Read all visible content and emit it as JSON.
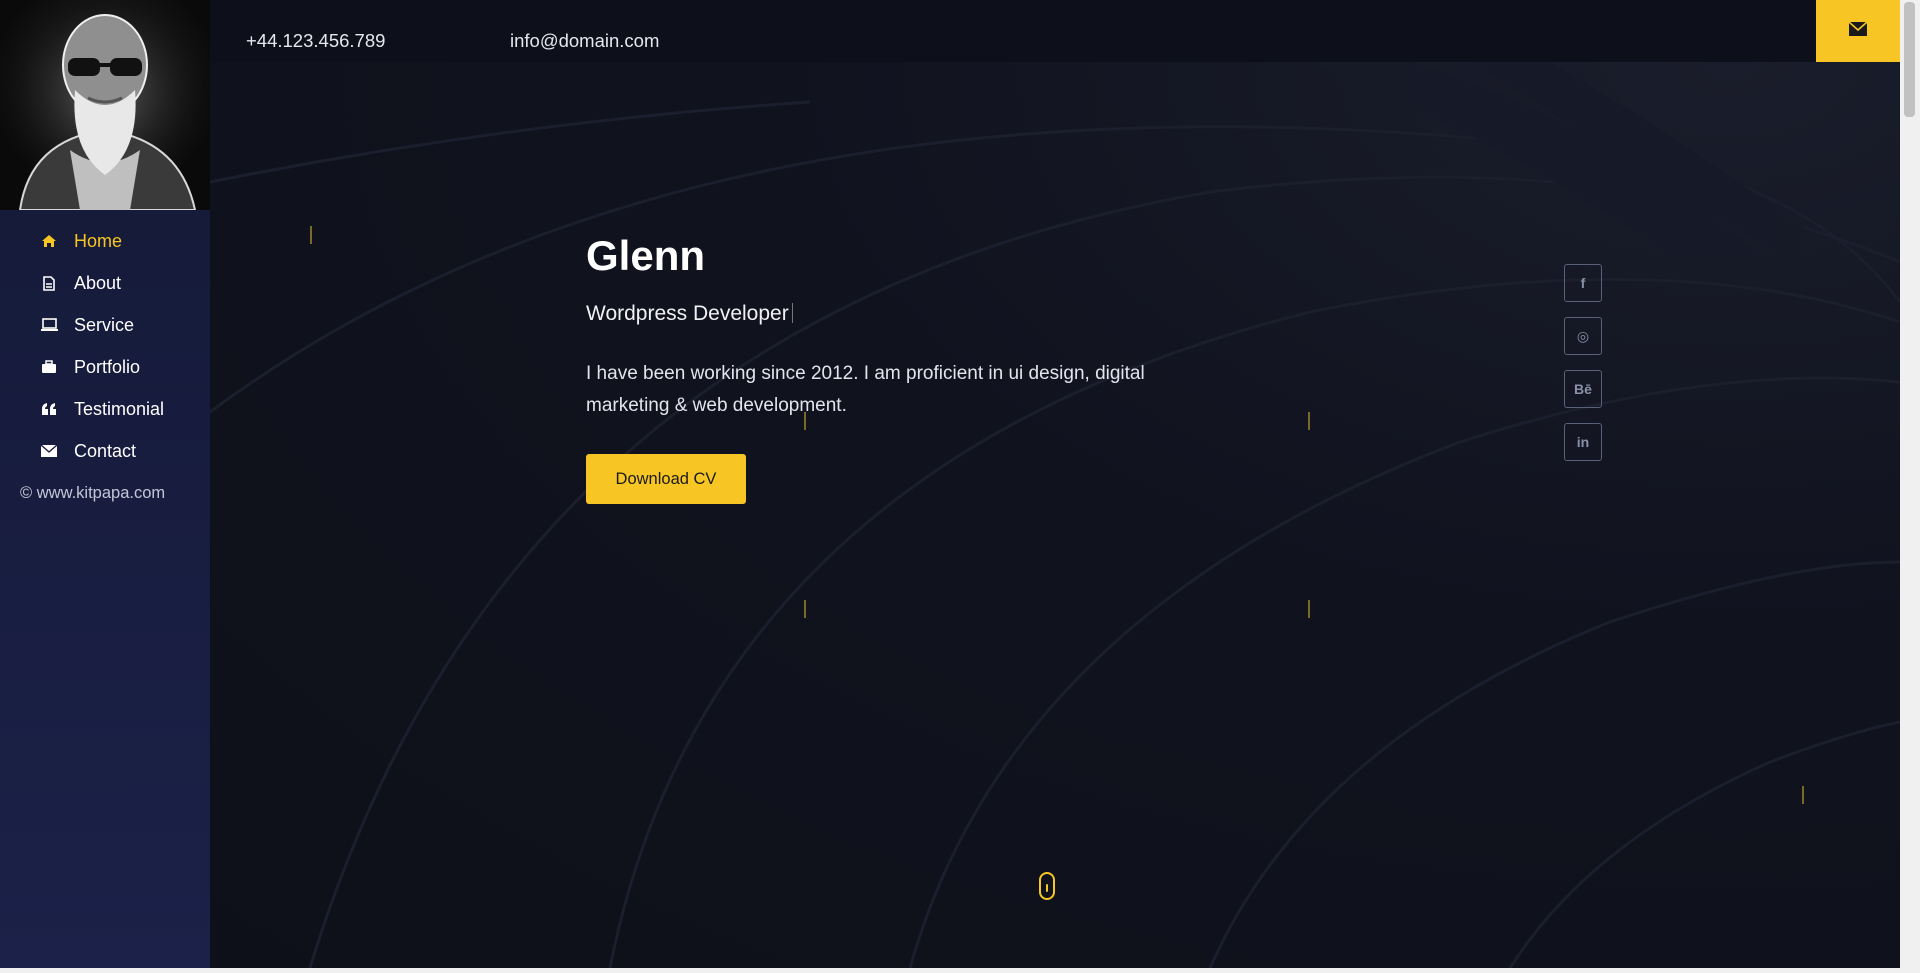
{
  "contact": {
    "phone": "+44.123.456.789",
    "email": "info@domain.com"
  },
  "sidebar": {
    "avatar_alt": "profile-avatar",
    "items": [
      {
        "label": "Home",
        "icon": "home-icon",
        "active": true
      },
      {
        "label": "About",
        "icon": "document-icon",
        "active": false
      },
      {
        "label": "Service",
        "icon": "laptop-icon",
        "active": false
      },
      {
        "label": "Portfolio",
        "icon": "briefcase-icon",
        "active": false
      },
      {
        "label": "Testimonial",
        "icon": "quote-icon",
        "active": false
      },
      {
        "label": "Contact",
        "icon": "envelope-icon",
        "active": false
      }
    ],
    "copyright": "© www.kitpapa.com"
  },
  "hero": {
    "name": "Glenn",
    "role": "Wordpress Developer",
    "bio": "I have been working since 2012. I am proficient in ui design, digital marketing & web development.",
    "cta_label": "Download CV"
  },
  "social": [
    {
      "name": "facebook-icon",
      "glyph": "f"
    },
    {
      "name": "dribbble-icon",
      "glyph": "◎"
    },
    {
      "name": "behance-icon",
      "glyph": "Bē"
    },
    {
      "name": "linkedin-icon",
      "glyph": "in"
    }
  ],
  "colors": {
    "accent": "#f7c624",
    "sidebar_bg": "#141936",
    "page_bg": "#0f111d"
  }
}
